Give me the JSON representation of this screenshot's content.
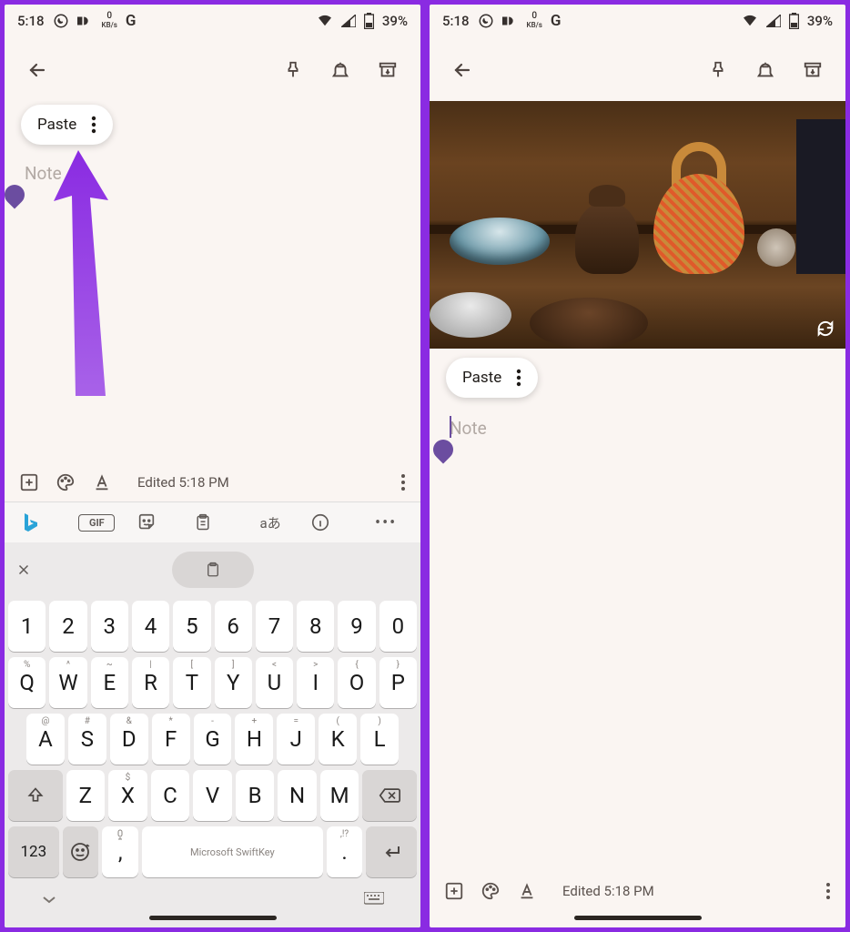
{
  "status": {
    "time": "5:18",
    "kbs_num": "0",
    "kbs_unit": "KB/s",
    "google": "G",
    "battery_pct": "39%"
  },
  "paste": {
    "label": "Paste"
  },
  "note": {
    "placeholder": "Note"
  },
  "toolbar": {
    "edited": "Edited 5:18 PM"
  },
  "keyboard": {
    "gif": "GIF",
    "lang": "aあ",
    "row_num": [
      "1",
      "2",
      "3",
      "4",
      "5",
      "6",
      "7",
      "8",
      "9",
      "0"
    ],
    "row_q": [
      "Q",
      "W",
      "E",
      "R",
      "T",
      "Y",
      "U",
      "I",
      "O",
      "P"
    ],
    "row_q_hints": [
      "%",
      "^",
      "~",
      "|",
      "[",
      "]",
      "<",
      ">",
      "{",
      "}"
    ],
    "row_a": [
      "A",
      "S",
      "D",
      "F",
      "G",
      "H",
      "J",
      "K",
      "L"
    ],
    "row_a_hints": [
      "@",
      "#",
      "&",
      "*",
      "-",
      "+",
      "=",
      "(",
      ")"
    ],
    "row_z": [
      "Z",
      "X",
      "C",
      "V",
      "B",
      "N",
      "M"
    ],
    "row_z_hints": [
      "—",
      "$",
      "€",
      "£",
      "¥",
      "—",
      "—"
    ],
    "sym": "123",
    "comma": ",",
    "space": "Microsoft SwiftKey",
    "period": ".",
    "period_hint": ",!?"
  }
}
